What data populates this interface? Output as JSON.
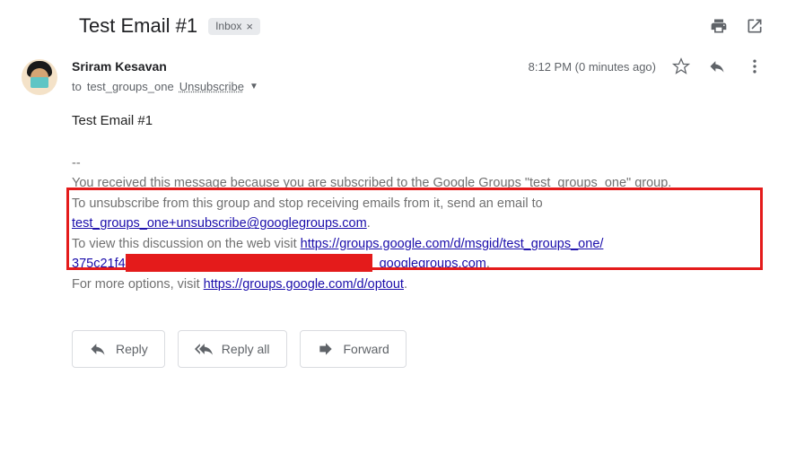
{
  "header": {
    "subject": "Test Email #1",
    "inbox_label": "Inbox",
    "inbox_close": "×"
  },
  "sender": {
    "name": "Sriram Kesavan",
    "to_prefix": "to",
    "to_recipient": "test_groups_one",
    "unsubscribe": "Unsubscribe",
    "timestamp": "8:12 PM (0 minutes ago)"
  },
  "body": {
    "content": "Test Email #1",
    "sep": "--",
    "line1a": "You received this message because you are subscribed to the Google Groups \"test_groups_one\" group.",
    "line2": "To unsubscribe from this group and stop receiving emails from it, send an email to ",
    "unsub_email": "test_groups_one+unsubscribe@googlegroups.com",
    "line3a": "To view this discussion on the web visit ",
    "discussion_link": "https://groups.google.com/d/msgid/test_groups_one/",
    "partial_id": "375c21f4-",
    "domain_tail": "googlegroups.com",
    "line5a": "For more options, visit ",
    "optout_link": "https://groups.google.com/d/optout"
  },
  "actions": {
    "reply": "Reply",
    "reply_all": "Reply all",
    "forward": "Forward"
  }
}
